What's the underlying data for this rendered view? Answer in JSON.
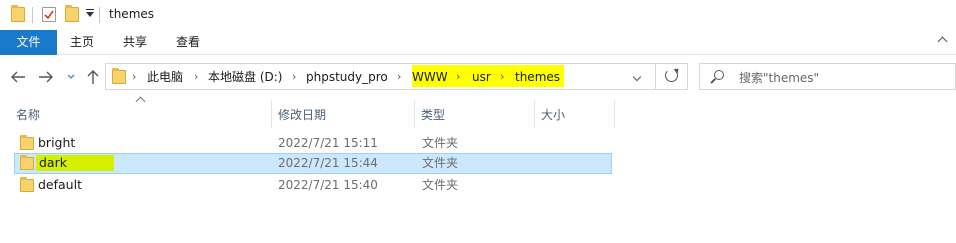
{
  "window": {
    "title": "themes"
  },
  "ribbon": {
    "tabs": [
      "文件",
      "主页",
      "共享",
      "查看"
    ]
  },
  "address": {
    "crumbs": [
      "此电脑",
      "本地磁盘 (D:)",
      "phpstudy_pro",
      "WWW",
      "usr",
      "themes"
    ],
    "highlight_color": "#ffff00"
  },
  "search": {
    "placeholder": "搜索\"themes\""
  },
  "columns": {
    "name": "名称",
    "date": "修改日期",
    "type": "类型",
    "size": "大小"
  },
  "files": [
    {
      "name": "bright",
      "date": "2022/7/21 15:11",
      "type": "文件夹",
      "selected": false
    },
    {
      "name": "dark",
      "date": "2022/7/21 15:44",
      "type": "文件夹",
      "selected": true
    },
    {
      "name": "default",
      "date": "2022/7/21 15:40",
      "type": "文件夹",
      "selected": false
    }
  ],
  "colors": {
    "accent": "#1979ca",
    "selection": "#cce8ff",
    "name_highlight": "#d4ef00"
  },
  "icons": {
    "folder": "folder-icon",
    "back": "back-arrow-icon",
    "forward": "forward-arrow-icon",
    "up": "up-arrow-icon",
    "refresh": "refresh-icon",
    "search": "search-icon"
  }
}
